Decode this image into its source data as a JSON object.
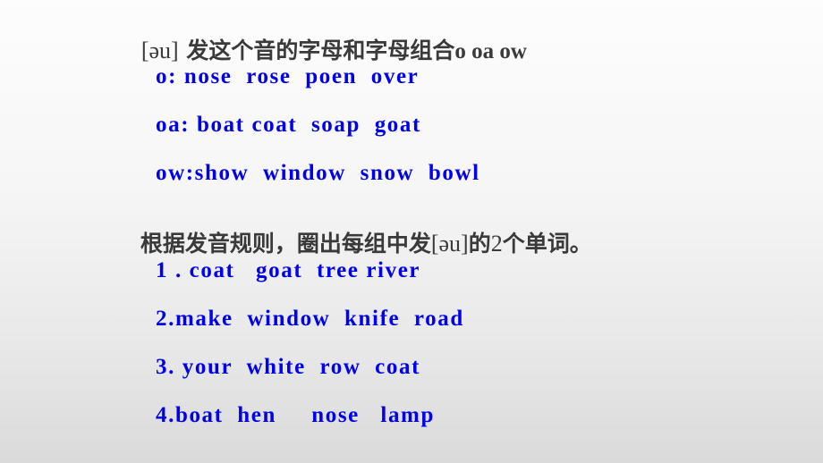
{
  "slide": {
    "title": {
      "phonetic": "[əu]",
      "text": " 发这个音的字母和字母组合",
      "letters": "o oa ow"
    },
    "spelling_groups": [
      {
        "label": "o: nose  rose  poen  over"
      },
      {
        "label": "oa: boat coat  soap  goat"
      },
      {
        "label": "ow:show  window  snow  bowl"
      }
    ],
    "instruction": {
      "prefix": "根据发音规则，圈出每组中发",
      "phonetic": "[əu]",
      "middle": "的",
      "number": "2",
      "suffix": "个单词。"
    },
    "exercises": [
      {
        "text": "1 . coat   goat  tree river"
      },
      {
        "text": "2.make  window  knife  road"
      },
      {
        "text": "3. your  white  row  coat"
      },
      {
        "text": "4.boat  hen     nose   lamp"
      }
    ],
    "colors": {
      "heading": "#3a3a3a",
      "words": "#0000ee",
      "background_top": "#fdfdfd",
      "background_bottom": "#dadada"
    }
  }
}
